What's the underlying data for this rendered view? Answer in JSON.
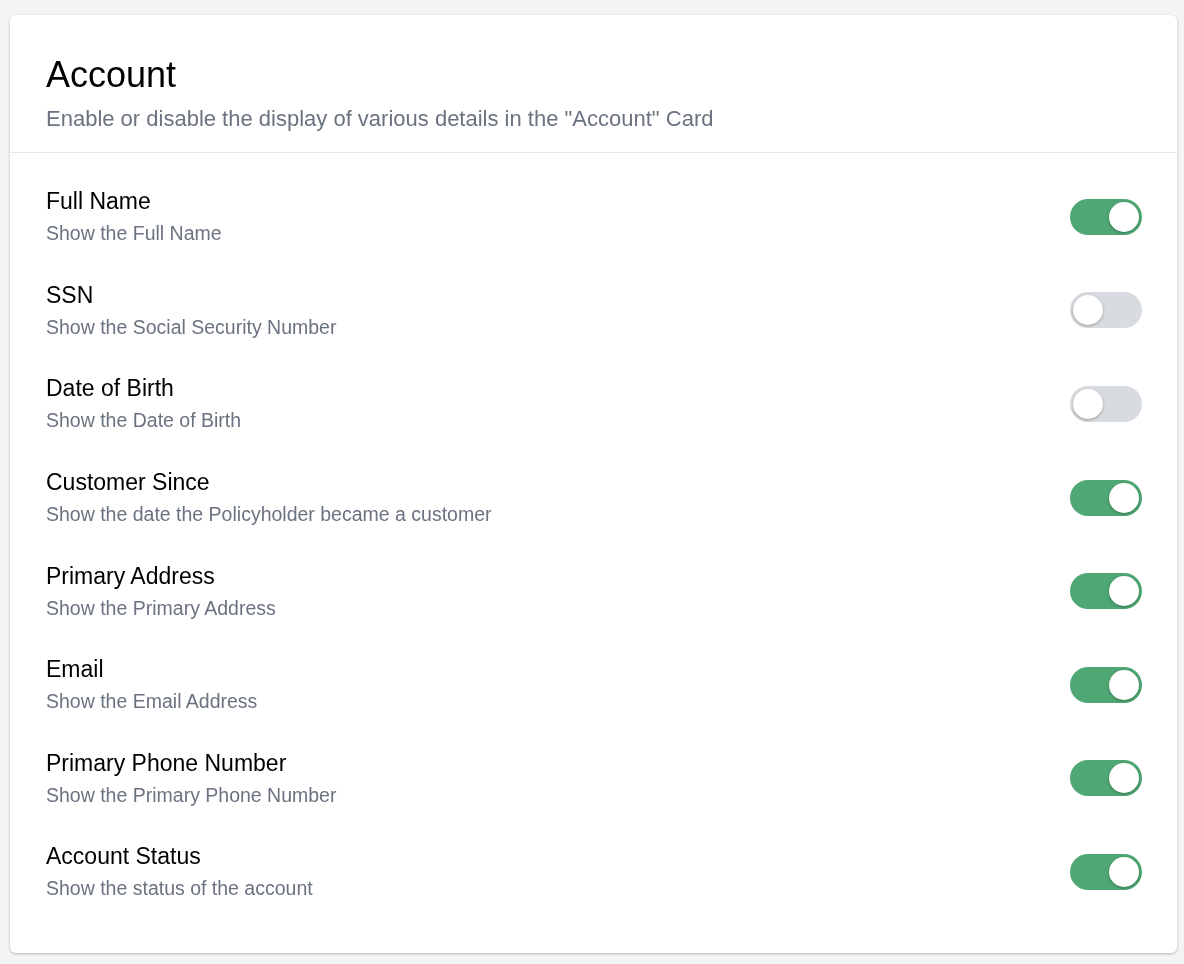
{
  "card": {
    "title": "Account",
    "subtitle": "Enable or disable the display of various details in the \"Account\" Card"
  },
  "settings": [
    {
      "label": "Full Name",
      "description": "Show the Full Name",
      "on": true
    },
    {
      "label": "SSN",
      "description": "Show the Social Security Number",
      "on": false
    },
    {
      "label": "Date of Birth",
      "description": "Show the Date of Birth",
      "on": false
    },
    {
      "label": "Customer Since",
      "description": "Show the date the Policyholder became a customer",
      "on": true
    },
    {
      "label": "Primary Address",
      "description": "Show the Primary Address",
      "on": true
    },
    {
      "label": "Email",
      "description": "Show the Email Address",
      "on": true
    },
    {
      "label": "Primary Phone Number",
      "description": "Show the Primary Phone Number",
      "on": true
    },
    {
      "label": "Account Status",
      "description": "Show the status of the account",
      "on": true
    }
  ]
}
